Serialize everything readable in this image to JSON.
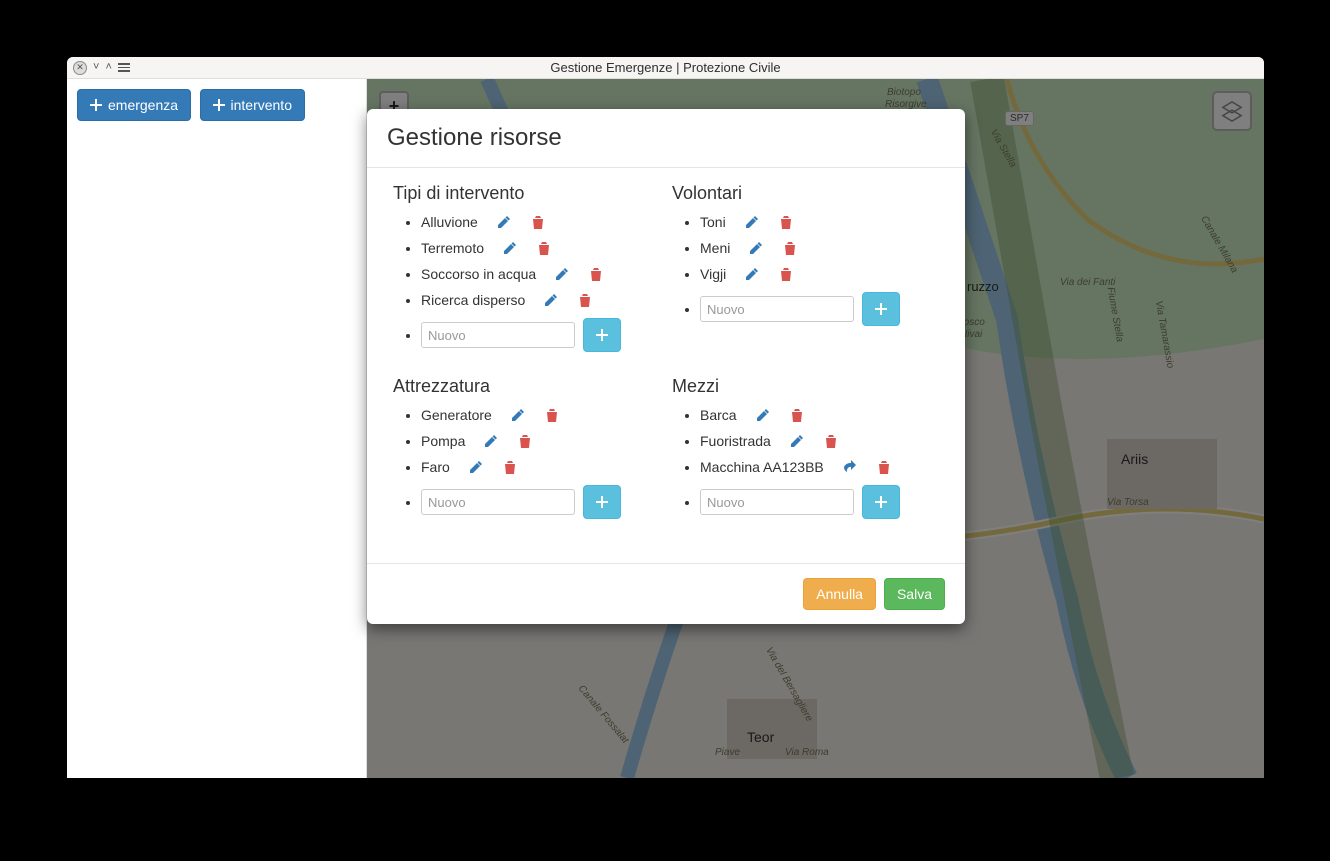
{
  "window": {
    "title": "Gestione Emergenze | Protezione Civile"
  },
  "sidebar": {
    "emergency_label": "emergenza",
    "intervention_label": "intervento"
  },
  "map": {
    "zoom_in": "+",
    "zoom_out": "−",
    "labels": {
      "biotopo": "Biotopo",
      "risorgive": "Risorgive",
      "bosco": "Bosco",
      "nivai": "Nivai",
      "via_fanti": "Via dei Fanti",
      "via_torsa": "Via Torsa",
      "via_stella": "Via Stella",
      "via_bersagliere": "Via del Bersagliere",
      "via_roma": "Via Roma",
      "canale_milana": "Canale Milana",
      "fiume_stella": "Fiume Stella",
      "tamarassio": "Via Tamarassio",
      "piave": "Piave",
      "canale_fossalat": "Canale Fossalat",
      "sp7": "SP7"
    },
    "towns": {
      "teor": "Teor",
      "ariis": "Ariis",
      "ruzzo": "ruzzo"
    }
  },
  "modal": {
    "title": "Gestione risorse",
    "new_placeholder": "Nuovo",
    "cancel": "Annulla",
    "save": "Salva",
    "sections": {
      "tipi": {
        "title": "Tipi di intervento",
        "items": [
          "Alluvione",
          "Terremoto",
          "Soccorso in acqua",
          "Ricerca disperso"
        ]
      },
      "volontari": {
        "title": "Volontari",
        "items": [
          "Toni",
          "Meni",
          "Vigji"
        ]
      },
      "attrezzatura": {
        "title": "Attrezzatura",
        "items": [
          "Generatore",
          "Pompa",
          "Faro"
        ]
      },
      "mezzi": {
        "title": "Mezzi",
        "items": [
          "Barca",
          "Fuoristrada",
          "Macchina AA123BB"
        ]
      }
    }
  }
}
